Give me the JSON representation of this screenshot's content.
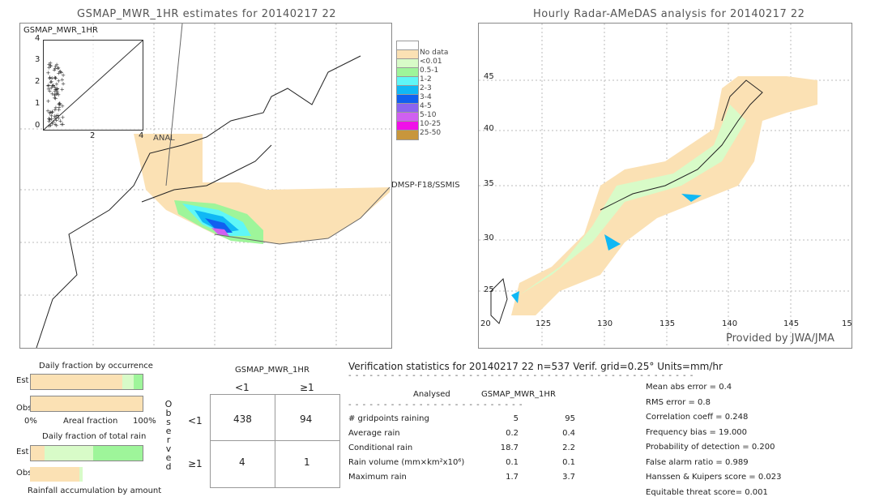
{
  "left_map": {
    "title": "GSMAP_MWR_1HR estimates for 20140217 22",
    "inset_label": "GSMAP_MWR_1HR",
    "inset_yticks": [
      "0",
      "1",
      "2",
      "3",
      "4"
    ],
    "inset_xticks": [
      "0",
      "2",
      "4"
    ],
    "anal_label": "ANAL",
    "sensor_label": "DMSP-F18/SSMIS"
  },
  "right_map": {
    "title": "Hourly Radar-AMeDAS analysis for 20140217 22",
    "lat_ticks": [
      "45",
      "40",
      "35",
      "30",
      "25",
      "20"
    ],
    "lon_ticks": [
      "125",
      "130",
      "135",
      "140",
      "145",
      "15"
    ],
    "credit": "Provided by JWA/JMA"
  },
  "legend": {
    "items": [
      {
        "label": "",
        "color": "#ffffff"
      },
      {
        "label": "No data",
        "color": "#fbe1b4"
      },
      {
        "label": "<0.01",
        "color": "#d8fbc8"
      },
      {
        "label": "0.5-1",
        "color": "#9ef59a"
      },
      {
        "label": "1-2",
        "color": "#5ff7f7"
      },
      {
        "label": "2-3",
        "color": "#10b8f5"
      },
      {
        "label": "3-4",
        "color": "#1060f0"
      },
      {
        "label": "4-5",
        "color": "#8c64f0"
      },
      {
        "label": "5-10",
        "color": "#d060f0"
      },
      {
        "label": "10-25",
        "color": "#f010e8"
      },
      {
        "label": "25-50",
        "color": "#c8963c"
      }
    ]
  },
  "occurrence": {
    "title": "Daily fraction by occurrence",
    "est": "Est",
    "obs": "Obs",
    "x0": "0%",
    "xlabel": "Areal fraction",
    "x1": "100%",
    "est_fractions": [
      0.82,
      0.1,
      0.08
    ],
    "obs_fractions": [
      1.0,
      0,
      0
    ]
  },
  "total_rain": {
    "title": "Daily fraction of total rain",
    "est": "Est",
    "obs": "Obs",
    "footer": "Rainfall accumulation by amount",
    "est_fractions": [
      0.12,
      0.44,
      0.44
    ],
    "obs_fractions": [
      0.44,
      0.03,
      0
    ]
  },
  "contingency": {
    "title": "GSMAP_MWR_1HR",
    "col_lt": "<1",
    "col_ge": "≥1",
    "row_lt": "<1",
    "row_ge": "≥1",
    "side": [
      "O",
      "b",
      "s",
      "e",
      "r",
      "v",
      "e",
      "d"
    ],
    "cells": [
      "438",
      "94",
      "4",
      "1"
    ]
  },
  "stats": {
    "header": "Verification statistics for 20140217 22  n=537  Verif. grid=0.25°  Units=mm/hr",
    "col1": "Analysed",
    "col2": "GSMAP_MWR_1HR",
    "rows": [
      {
        "label": "# gridpoints raining",
        "a": "5",
        "b": "95"
      },
      {
        "label": "Average rain",
        "a": "0.2",
        "b": "0.4"
      },
      {
        "label": "Conditional rain",
        "a": "18.7",
        "b": "2.2"
      },
      {
        "label": "Rain volume (mm×km²x10⁶)",
        "a": "0.1",
        "b": "0.1"
      },
      {
        "label": "Maximum rain",
        "a": "1.7",
        "b": "3.7"
      }
    ],
    "scores": [
      "Mean abs error = 0.4",
      "RMS error = 0.8",
      "Correlation coeff = 0.248",
      "Frequency bias = 19.000",
      "Probability of detection = 0.200",
      "False alarm ratio = 0.989",
      "Hanssen & Kuipers score = 0.023",
      "Equitable threat score= 0.001"
    ]
  }
}
